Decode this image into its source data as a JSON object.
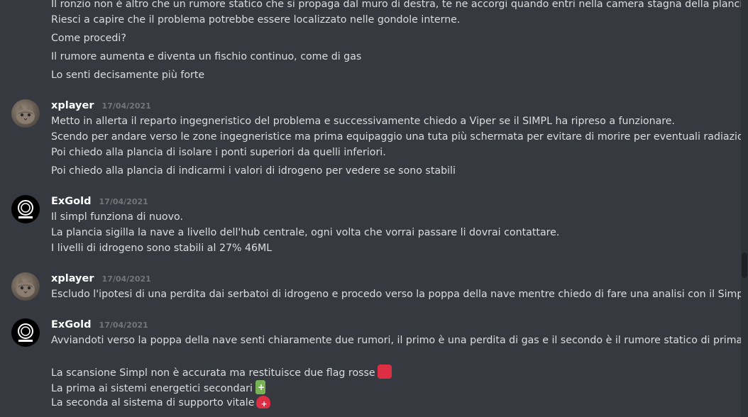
{
  "intro_lines": [
    "Il ronzio non è altro che un rumore statico che si propaga dal muro di destra, te ne accorgi quando entri nella camera stagna della plancia.",
    "Riesci a capire che il problema potrebbe essere localizzato nelle gondole interne.",
    "Come procedi?",
    "Il rumore aumenta e diventa un fischio continuo, come di gas",
    "Lo senti decisamente più forte"
  ],
  "messages": [
    {
      "author": "xplayer",
      "timestamp": "17/04/2021",
      "lines": [
        "Metto in allerta il reparto ingegneristico del problema e successivamente chiedo a Viper se il SIMPL ha ripreso a funzionare.",
        "Scendo per andare verso le zone ingegneristice ma prima equipaggio una tuta più schermata per evitare di morire per eventuali radiazioni.",
        "Poi chiedo alla plancia di isolare i ponti superiori da quelli inferiori.",
        "Poi chiedo alla plancia di indicarmi i valori di idrogeno per vedere se sono stabili"
      ]
    },
    {
      "author": "ExGold",
      "timestamp": "17/04/2021",
      "lines": [
        "Il simpl funziona di nuovo.",
        "La plancia sigilla la nave a livello dell'hub centrale, ogni volta che vorrai passare li dovrai contattare.",
        "I livelli di idrogeno sono stabili al 27% 46ML"
      ]
    },
    {
      "author": "xplayer",
      "timestamp": "17/04/2021",
      "lines": [
        "Escludo l'ipotesi di una perdita dai serbatoi di idrogeno e procedo verso la poppa della nave mentre chiedo di fare una analisi con il Simpl."
      ]
    },
    {
      "author": "ExGold",
      "timestamp": "17/04/2021",
      "lines": [
        "Avviandoti verso la poppa della nave senti chiaramente due rumori, il primo è una perdita di gas e il secondo è il rumore statico di prima.",
        "La scansione Simpl non è accurata ma restituisce due flag rosse",
        "La prima ai sistemi energetici secondari",
        "La seconda al sistema di supporto vitale"
      ]
    }
  ],
  "emoji": {
    "red_square": "red-square",
    "battery": "battery",
    "helmet": "rescue-helmet"
  },
  "colors": {
    "background": "#36393f",
    "text": "#dcddde",
    "author": "#ffffff",
    "timestamp": "#72767d"
  }
}
